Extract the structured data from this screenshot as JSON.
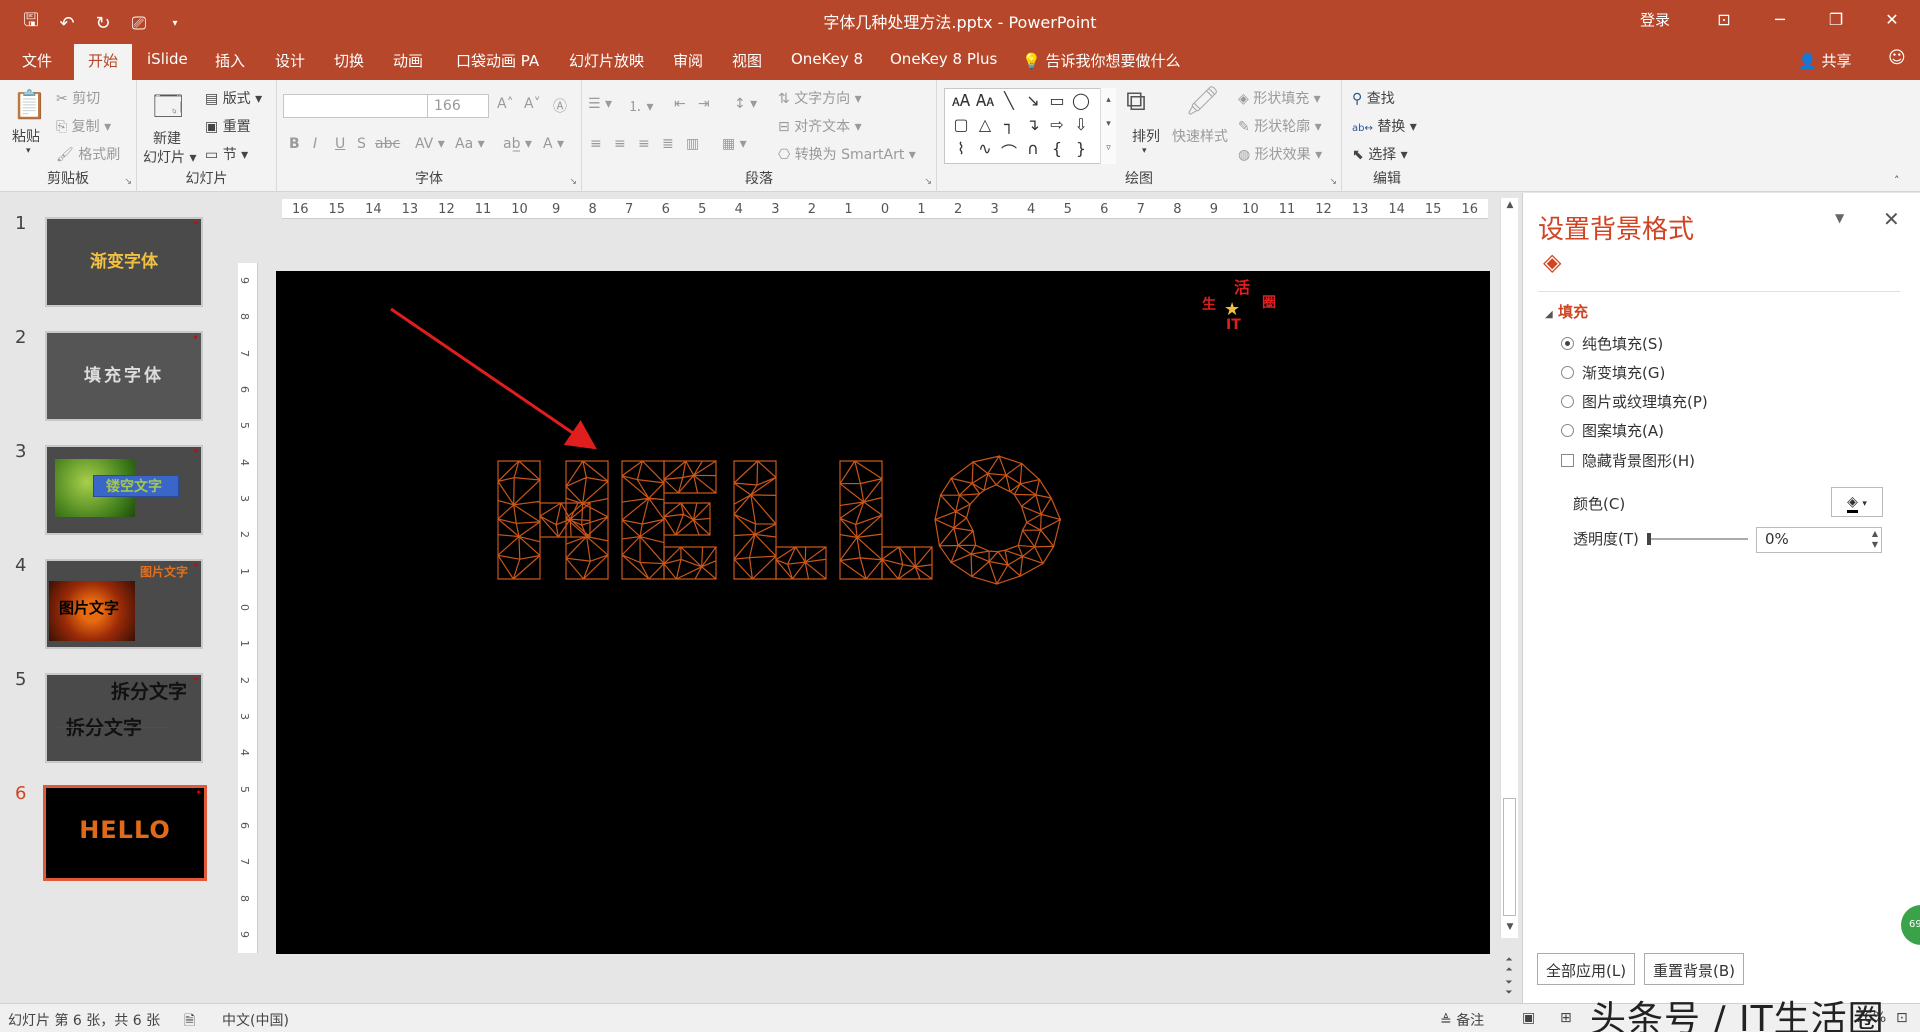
{
  "titlebar": {
    "title": "字体几种处理方法.pptx - PowerPoint",
    "login": "登录",
    "qat_icons": [
      "save-icon",
      "undo-icon",
      "redo-icon",
      "present-icon",
      "customize-icon"
    ]
  },
  "tabs": {
    "file": "文件",
    "home": "开始",
    "islide": "iSlide",
    "insert": "插入",
    "design": "设计",
    "transitions": "切换",
    "animations": "动画",
    "pocket": "口袋动画 PA",
    "slideshow": "幻灯片放映",
    "review": "审阅",
    "view": "视图",
    "onekey8": "OneKey 8",
    "onekey8plus": "OneKey 8 Plus",
    "tellme": "告诉我你想要做什么",
    "share": "共享"
  },
  "ribbon": {
    "clipboard": {
      "paste": "粘贴",
      "cut": "剪切",
      "copy": "复制",
      "format_painter": "格式刷",
      "label": "剪贴板"
    },
    "slides": {
      "new_slide_1": "新建",
      "new_slide_2": "幻灯片",
      "layout": "版式",
      "reset": "重置",
      "section": "节",
      "label": "幻灯片"
    },
    "font": {
      "font_name": "",
      "font_size": "166",
      "label": "字体"
    },
    "paragraph": {
      "text_direction": "文字方向",
      "align_text": "对齐文本",
      "smartart": "转换为 SmartArt",
      "label": "段落"
    },
    "drawing": {
      "arrange": "排列",
      "quick_styles": "快速样式",
      "shape_fill": "形状填充",
      "shape_outline": "形状轮廓",
      "shape_effects": "形状效果",
      "label": "绘图"
    },
    "editing": {
      "find": "查找",
      "replace": "替换",
      "select": "选择",
      "label": "编辑"
    }
  },
  "thumbnails": [
    {
      "num": "1",
      "text": "渐变字体"
    },
    {
      "num": "2",
      "text": "填充字体"
    },
    {
      "num": "3",
      "text": "镂空文字"
    },
    {
      "num": "4",
      "text": "图片文字"
    },
    {
      "num": "5",
      "text": "拆分文字",
      "text2": "拆分文字"
    },
    {
      "num": "6",
      "text": "HELLO"
    }
  ],
  "ruler": {
    "h": [
      "16",
      "15",
      "14",
      "13",
      "12",
      "11",
      "10",
      "9",
      "8",
      "7",
      "6",
      "5",
      "4",
      "3",
      "2",
      "1",
      "0",
      "1",
      "2",
      "3",
      "4",
      "5",
      "6",
      "7",
      "8",
      "9",
      "10",
      "11",
      "12",
      "13",
      "14",
      "15",
      "16"
    ],
    "v": [
      "9",
      "8",
      "7",
      "6",
      "5",
      "4",
      "3",
      "2",
      "1",
      "0",
      "1",
      "2",
      "3",
      "4",
      "5",
      "6",
      "7",
      "8",
      "9"
    ]
  },
  "slide": {
    "text": "HELLO",
    "logo": [
      "活",
      "圈",
      "IT",
      "生"
    ],
    "colors": {
      "background": "#000000",
      "wire": "#c8561a",
      "arrow": "#e01e1e"
    }
  },
  "pane": {
    "title": "设置背景格式",
    "section": "填充",
    "options": [
      "纯色填充(S)",
      "渐变填充(G)",
      "图片或纹理填充(P)",
      "图案填充(A)"
    ],
    "hide_bg": "隐藏背景图形(H)",
    "color_label": "颜色(C)",
    "transparency_label": "透明度(T)",
    "transparency_value": "0%",
    "transparency": 0,
    "apply_all": "全部应用(L)",
    "reset_bg": "重置背景(B)",
    "badge": "69"
  },
  "status": {
    "slide_info": "幻灯片 第 6 张，共 6 张",
    "language": "中文(中国)",
    "notes": "备注",
    "zoom": "76%",
    "watermark": "头条号 / IT生活圈"
  },
  "colors": {
    "accent": "#b7472a",
    "accent_text": "#d04423"
  }
}
